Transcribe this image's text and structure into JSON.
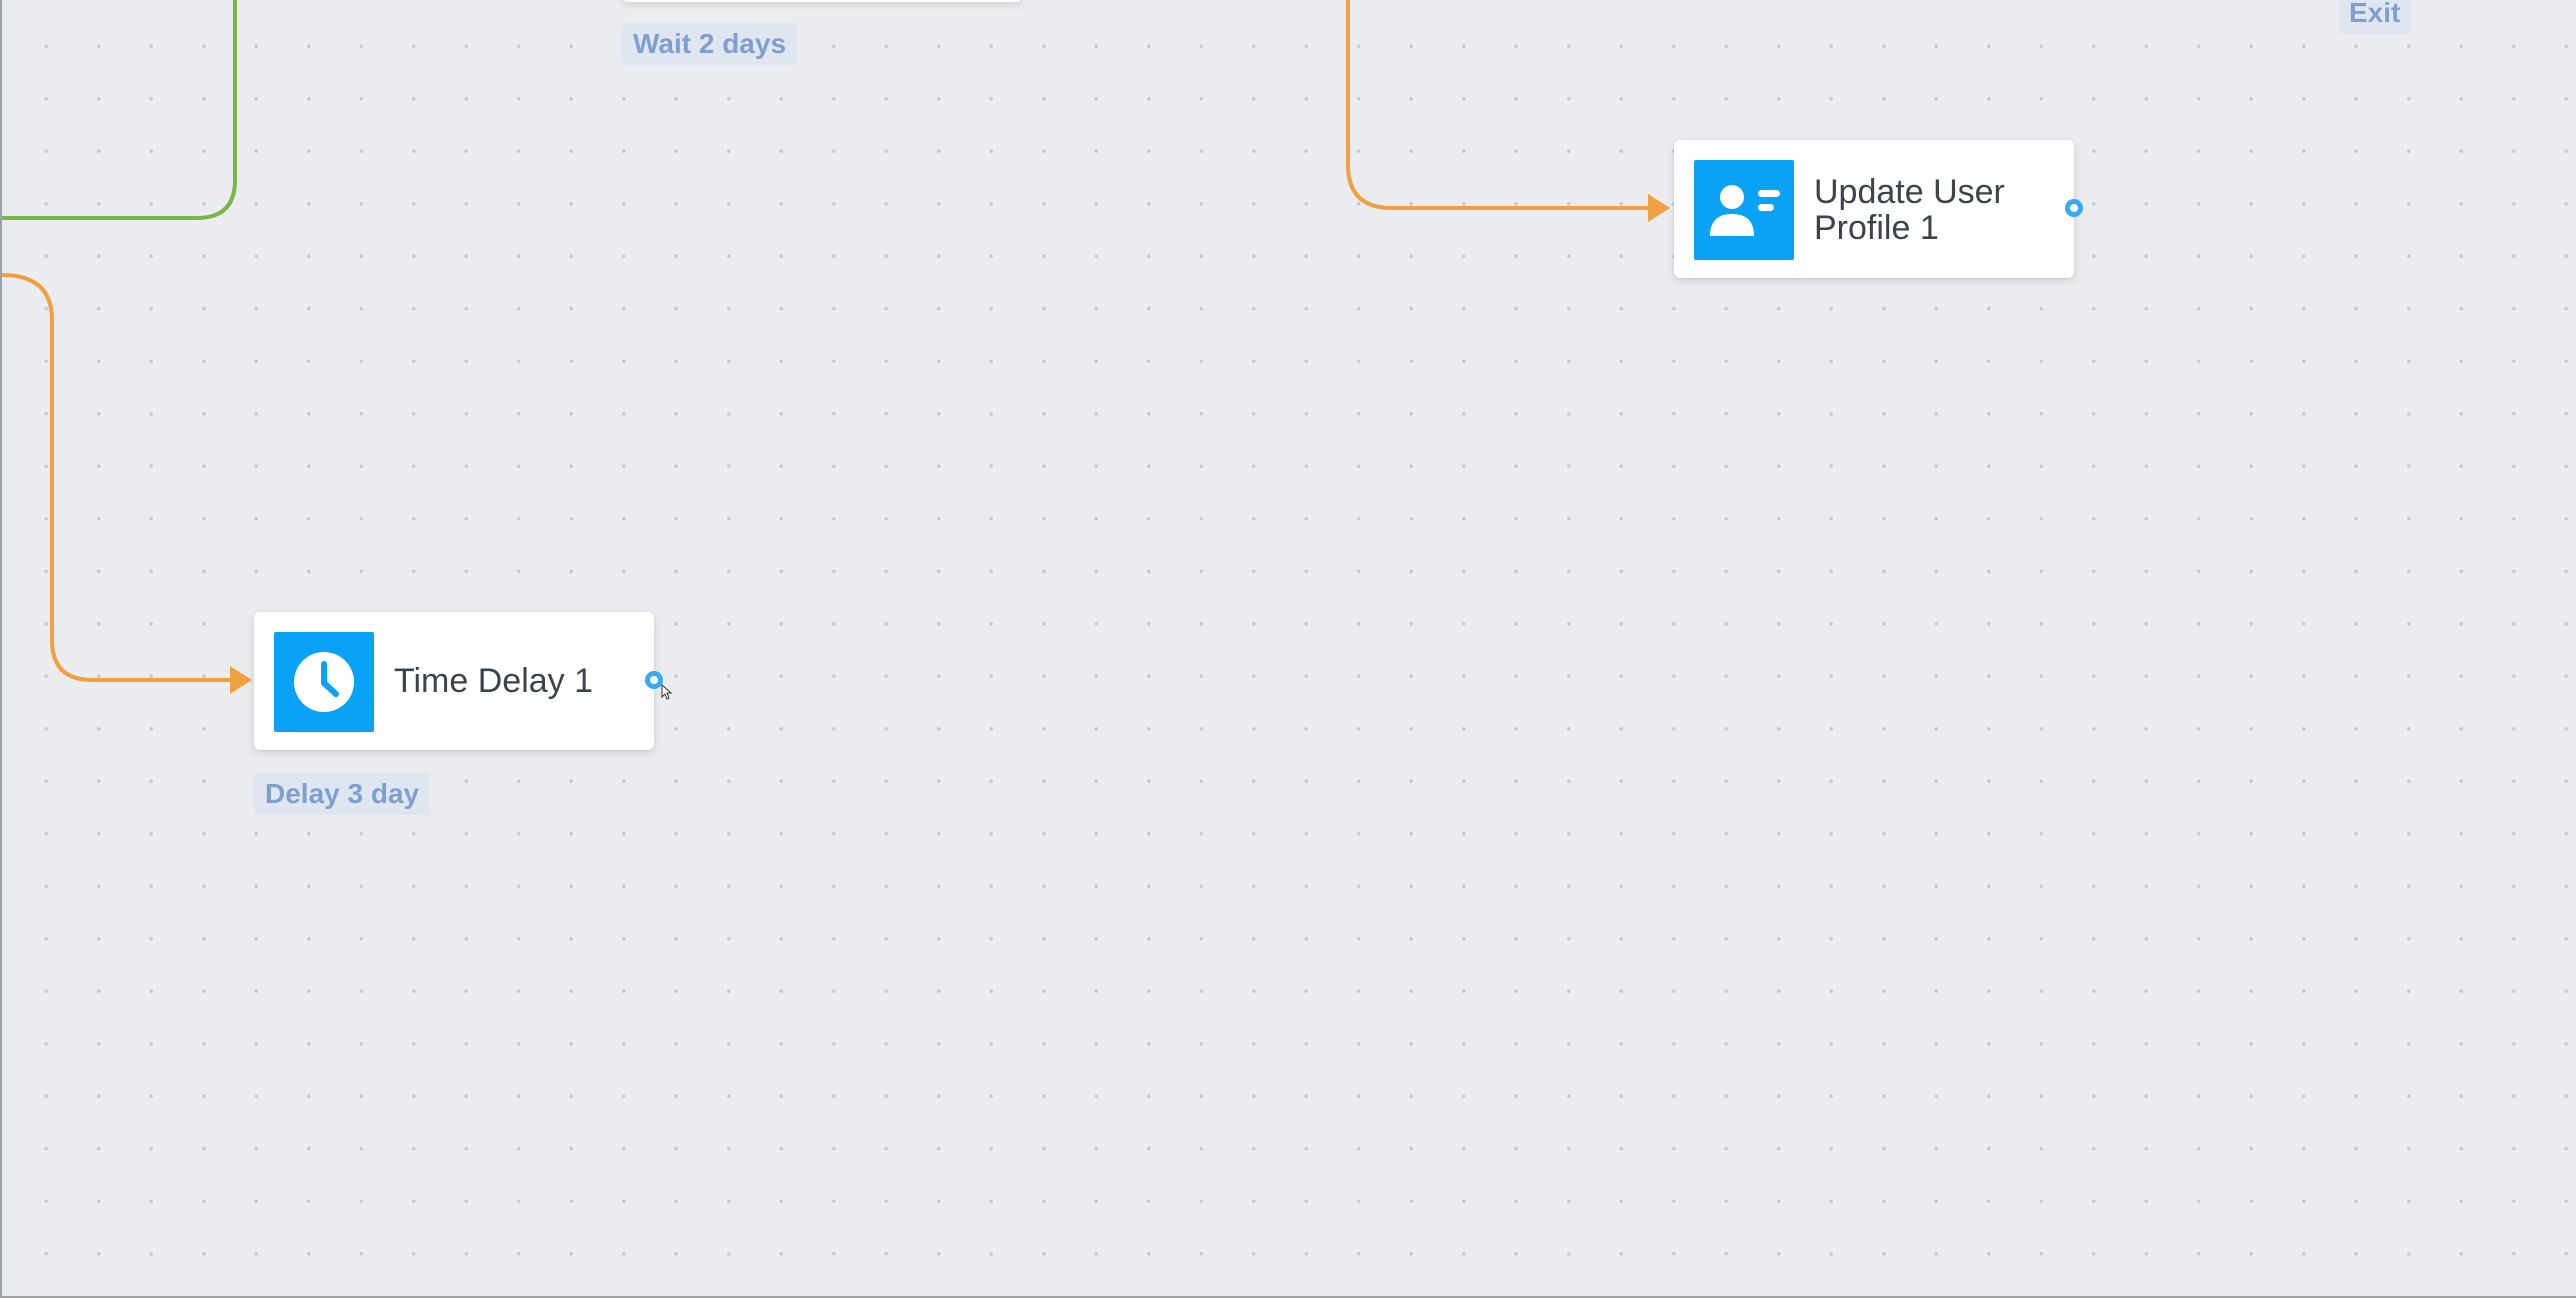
{
  "nodes": {
    "update_user_profile": {
      "title": "Update User Profile 1",
      "icon": "user-profile-card-icon"
    },
    "time_delay": {
      "title": "Time Delay 1",
      "icon": "clock-icon"
    }
  },
  "labels": {
    "wait": "Wait 2 days",
    "delay": "Delay 3 day",
    "exit": "Exit"
  },
  "colors": {
    "canvas_bg": "#eaecef",
    "node_icon_bg": "#0aa2f5",
    "wire_orange": "#f0a040",
    "wire_green": "#7ab648",
    "port_blue": "#39a9f2",
    "tag_text": "#7ea0cf",
    "tag_bg": "#dfe6f0"
  }
}
